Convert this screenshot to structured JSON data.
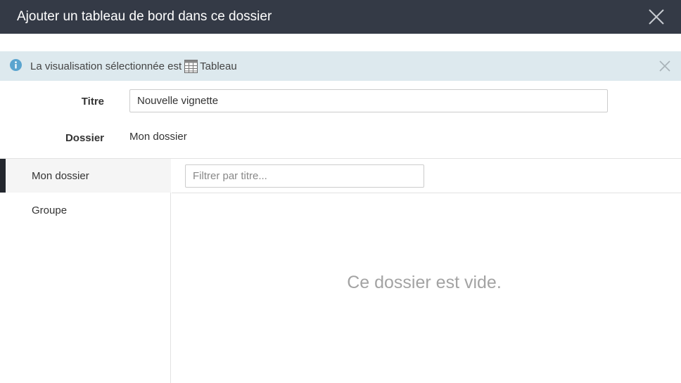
{
  "dialog": {
    "title": "Ajouter un tableau de bord dans ce dossier"
  },
  "info": {
    "text_before": "La visualisation sélectionnée est",
    "visualization": "Tableau"
  },
  "form": {
    "title_label": "Titre",
    "title_value": "Nouvelle vignette",
    "folder_label": "Dossier",
    "folder_value": "Mon dossier"
  },
  "sidebar": {
    "items": [
      {
        "label": "Mon dossier",
        "active": true
      },
      {
        "label": "Groupe",
        "active": false
      }
    ]
  },
  "filter": {
    "placeholder": "Filtrer par titre..."
  },
  "content": {
    "empty_message": "Ce dossier est vide."
  },
  "colors": {
    "header_bg": "#343a46",
    "info_bg": "#dde9ee",
    "info_icon": "#5aa4cf",
    "active_marker": "#23272e"
  },
  "icons": [
    "close-icon",
    "info-icon",
    "table-icon",
    "info-close-icon"
  ]
}
